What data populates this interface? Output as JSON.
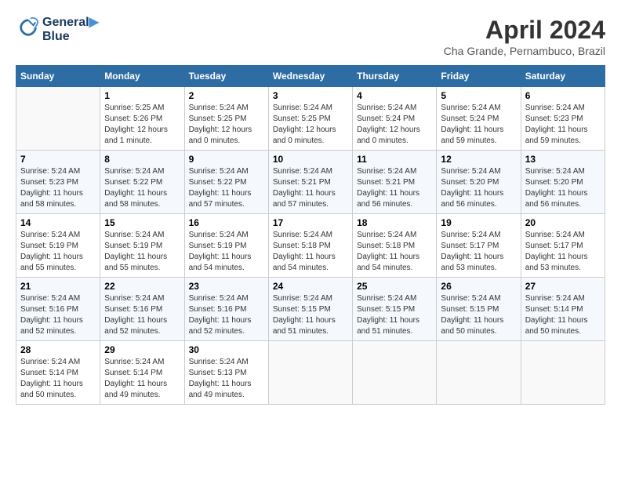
{
  "header": {
    "logo_line1": "General",
    "logo_line2": "Blue",
    "month_year": "April 2024",
    "location": "Cha Grande, Pernambuco, Brazil"
  },
  "weekdays": [
    "Sunday",
    "Monday",
    "Tuesday",
    "Wednesday",
    "Thursday",
    "Friday",
    "Saturday"
  ],
  "weeks": [
    [
      {
        "day": "",
        "info": ""
      },
      {
        "day": "1",
        "info": "Sunrise: 5:25 AM\nSunset: 5:26 PM\nDaylight: 12 hours\nand 1 minute."
      },
      {
        "day": "2",
        "info": "Sunrise: 5:24 AM\nSunset: 5:25 PM\nDaylight: 12 hours\nand 0 minutes."
      },
      {
        "day": "3",
        "info": "Sunrise: 5:24 AM\nSunset: 5:25 PM\nDaylight: 12 hours\nand 0 minutes."
      },
      {
        "day": "4",
        "info": "Sunrise: 5:24 AM\nSunset: 5:24 PM\nDaylight: 12 hours\nand 0 minutes."
      },
      {
        "day": "5",
        "info": "Sunrise: 5:24 AM\nSunset: 5:24 PM\nDaylight: 11 hours\nand 59 minutes."
      },
      {
        "day": "6",
        "info": "Sunrise: 5:24 AM\nSunset: 5:23 PM\nDaylight: 11 hours\nand 59 minutes."
      }
    ],
    [
      {
        "day": "7",
        "info": "Sunrise: 5:24 AM\nSunset: 5:23 PM\nDaylight: 11 hours\nand 58 minutes."
      },
      {
        "day": "8",
        "info": "Sunrise: 5:24 AM\nSunset: 5:22 PM\nDaylight: 11 hours\nand 58 minutes."
      },
      {
        "day": "9",
        "info": "Sunrise: 5:24 AM\nSunset: 5:22 PM\nDaylight: 11 hours\nand 57 minutes."
      },
      {
        "day": "10",
        "info": "Sunrise: 5:24 AM\nSunset: 5:21 PM\nDaylight: 11 hours\nand 57 minutes."
      },
      {
        "day": "11",
        "info": "Sunrise: 5:24 AM\nSunset: 5:21 PM\nDaylight: 11 hours\nand 56 minutes."
      },
      {
        "day": "12",
        "info": "Sunrise: 5:24 AM\nSunset: 5:20 PM\nDaylight: 11 hours\nand 56 minutes."
      },
      {
        "day": "13",
        "info": "Sunrise: 5:24 AM\nSunset: 5:20 PM\nDaylight: 11 hours\nand 56 minutes."
      }
    ],
    [
      {
        "day": "14",
        "info": "Sunrise: 5:24 AM\nSunset: 5:19 PM\nDaylight: 11 hours\nand 55 minutes."
      },
      {
        "day": "15",
        "info": "Sunrise: 5:24 AM\nSunset: 5:19 PM\nDaylight: 11 hours\nand 55 minutes."
      },
      {
        "day": "16",
        "info": "Sunrise: 5:24 AM\nSunset: 5:19 PM\nDaylight: 11 hours\nand 54 minutes."
      },
      {
        "day": "17",
        "info": "Sunrise: 5:24 AM\nSunset: 5:18 PM\nDaylight: 11 hours\nand 54 minutes."
      },
      {
        "day": "18",
        "info": "Sunrise: 5:24 AM\nSunset: 5:18 PM\nDaylight: 11 hours\nand 54 minutes."
      },
      {
        "day": "19",
        "info": "Sunrise: 5:24 AM\nSunset: 5:17 PM\nDaylight: 11 hours\nand 53 minutes."
      },
      {
        "day": "20",
        "info": "Sunrise: 5:24 AM\nSunset: 5:17 PM\nDaylight: 11 hours\nand 53 minutes."
      }
    ],
    [
      {
        "day": "21",
        "info": "Sunrise: 5:24 AM\nSunset: 5:16 PM\nDaylight: 11 hours\nand 52 minutes."
      },
      {
        "day": "22",
        "info": "Sunrise: 5:24 AM\nSunset: 5:16 PM\nDaylight: 11 hours\nand 52 minutes."
      },
      {
        "day": "23",
        "info": "Sunrise: 5:24 AM\nSunset: 5:16 PM\nDaylight: 11 hours\nand 52 minutes."
      },
      {
        "day": "24",
        "info": "Sunrise: 5:24 AM\nSunset: 5:15 PM\nDaylight: 11 hours\nand 51 minutes."
      },
      {
        "day": "25",
        "info": "Sunrise: 5:24 AM\nSunset: 5:15 PM\nDaylight: 11 hours\nand 51 minutes."
      },
      {
        "day": "26",
        "info": "Sunrise: 5:24 AM\nSunset: 5:15 PM\nDaylight: 11 hours\nand 50 minutes."
      },
      {
        "day": "27",
        "info": "Sunrise: 5:24 AM\nSunset: 5:14 PM\nDaylight: 11 hours\nand 50 minutes."
      }
    ],
    [
      {
        "day": "28",
        "info": "Sunrise: 5:24 AM\nSunset: 5:14 PM\nDaylight: 11 hours\nand 50 minutes."
      },
      {
        "day": "29",
        "info": "Sunrise: 5:24 AM\nSunset: 5:14 PM\nDaylight: 11 hours\nand 49 minutes."
      },
      {
        "day": "30",
        "info": "Sunrise: 5:24 AM\nSunset: 5:13 PM\nDaylight: 11 hours\nand 49 minutes."
      },
      {
        "day": "",
        "info": ""
      },
      {
        "day": "",
        "info": ""
      },
      {
        "day": "",
        "info": ""
      },
      {
        "day": "",
        "info": ""
      }
    ]
  ]
}
